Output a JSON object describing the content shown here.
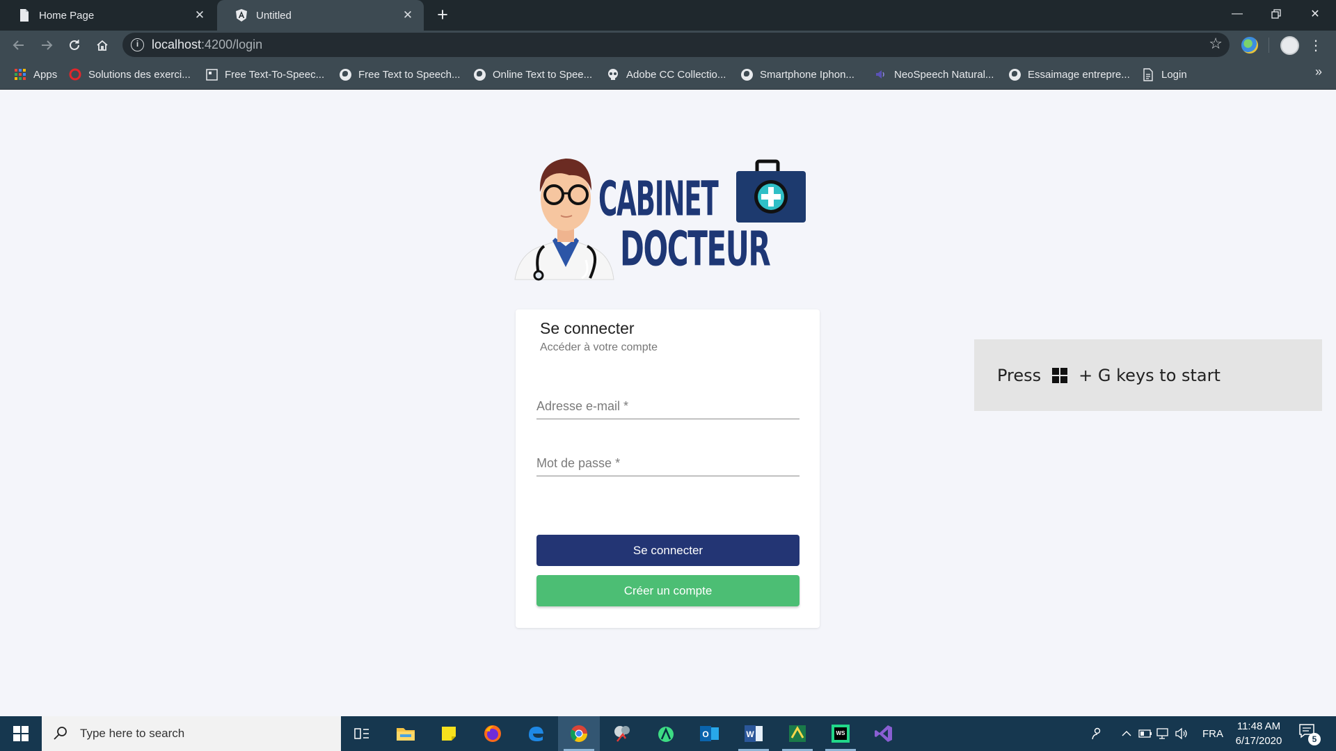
{
  "browser": {
    "tabs": [
      {
        "title": "Home Page",
        "icon": "document-icon"
      },
      {
        "title": "Untitled",
        "icon": "angular-icon",
        "active": true
      }
    ],
    "address": {
      "host": "localhost",
      "path": ":4200/login"
    },
    "bookmarks": [
      {
        "label": "Apps",
        "icon": "apps-grid-icon"
      },
      {
        "label": "Solutions des exerci...",
        "icon": "red-circle-icon"
      },
      {
        "label": "Free Text-To-Speec...",
        "icon": "square-icon"
      },
      {
        "label": "Free Text to Speech...",
        "icon": "globe-icon"
      },
      {
        "label": "Online Text to Spee...",
        "icon": "globe-icon"
      },
      {
        "label": "Adobe CC Collectio...",
        "icon": "skull-icon"
      },
      {
        "label": "Smartphone Iphon...",
        "icon": "globe-icon"
      },
      {
        "label": "NeoSpeech Natural...",
        "icon": "speaker-icon"
      },
      {
        "label": "Essaimage entrepre...",
        "icon": "globe-icon"
      },
      {
        "label": "Login",
        "icon": "document-icon"
      }
    ]
  },
  "logo": {
    "line1": "CABINET",
    "line2": "DOCTEUR"
  },
  "login": {
    "title": "Se connecter",
    "subtitle": "Accéder à votre compte",
    "email_placeholder": "Adresse e-mail *",
    "password_placeholder": "Mot de passe *",
    "login_button": "Se connecter",
    "register_button": "Créer un compte"
  },
  "gamebar": {
    "prefix": "Press",
    "suffix": "+ G keys to start"
  },
  "taskbar": {
    "search_placeholder": "Type here to search",
    "language": "FRA",
    "time": "11:48 AM",
    "date": "6/17/2020",
    "notification_count": "5"
  },
  "colors": {
    "navy": "#233574",
    "green": "#4cbe74",
    "chrome_dark": "#1f282d",
    "chrome_toolbar": "#3d4a52",
    "taskbar": "#16374f"
  }
}
